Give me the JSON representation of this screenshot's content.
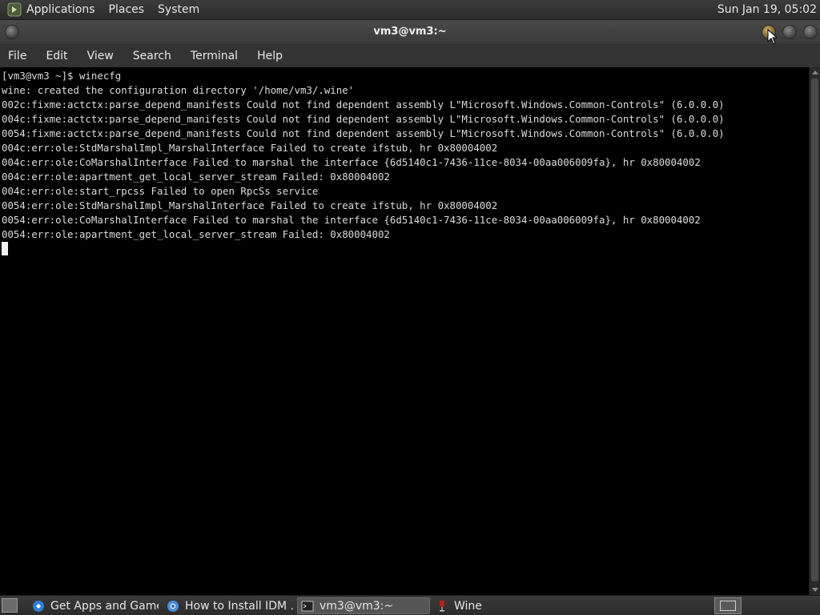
{
  "top_panel": {
    "menus": [
      "Applications",
      "Places",
      "System"
    ],
    "clock": "Sun Jan 19, 05:02"
  },
  "window": {
    "title": "vm3@vm3:~"
  },
  "menubar": {
    "items": [
      "File",
      "Edit",
      "View",
      "Search",
      "Terminal",
      "Help"
    ]
  },
  "terminal": {
    "lines": [
      "[vm3@vm3 ~]$ winecfg",
      "wine: created the configuration directory '/home/vm3/.wine'",
      "002c:fixme:actctx:parse_depend_manifests Could not find dependent assembly L\"Microsoft.Windows.Common-Controls\" (6.0.0.0)",
      "004c:fixme:actctx:parse_depend_manifests Could not find dependent assembly L\"Microsoft.Windows.Common-Controls\" (6.0.0.0)",
      "0054:fixme:actctx:parse_depend_manifests Could not find dependent assembly L\"Microsoft.Windows.Common-Controls\" (6.0.0.0)",
      "004c:err:ole:StdMarshalImpl_MarshalInterface Failed to create ifstub, hr 0x80004002",
      "004c:err:ole:CoMarshalInterface Failed to marshal the interface {6d5140c1-7436-11ce-8034-00aa006009fa}, hr 0x80004002",
      "004c:err:ole:apartment_get_local_server_stream Failed: 0x80004002",
      "004c:err:ole:start_rpcss Failed to open RpcSs service",
      "0054:err:ole:StdMarshalImpl_MarshalInterface Failed to create ifstub, hr 0x80004002",
      "0054:err:ole:CoMarshalInterface Failed to marshal the interface {6d5140c1-7436-11ce-8034-00aa006009fa}, hr 0x80004002",
      "0054:err:ole:apartment_get_local_server_stream Failed: 0x80004002"
    ]
  },
  "taskbar": {
    "tasks": [
      {
        "label": "Get Apps and Games",
        "icon": "app-store-icon"
      },
      {
        "label": "How to Install IDM ...",
        "icon": "browser-icon"
      },
      {
        "label": "vm3@vm3:~",
        "icon": "terminal-icon"
      },
      {
        "label": "Wine",
        "icon": "wine-glass-icon"
      }
    ]
  },
  "colors": {
    "panel_bg": "#333333",
    "terminal_bg": "#000000",
    "terminal_fg": "#dcdcdc",
    "active_task_bg": "#555555"
  }
}
